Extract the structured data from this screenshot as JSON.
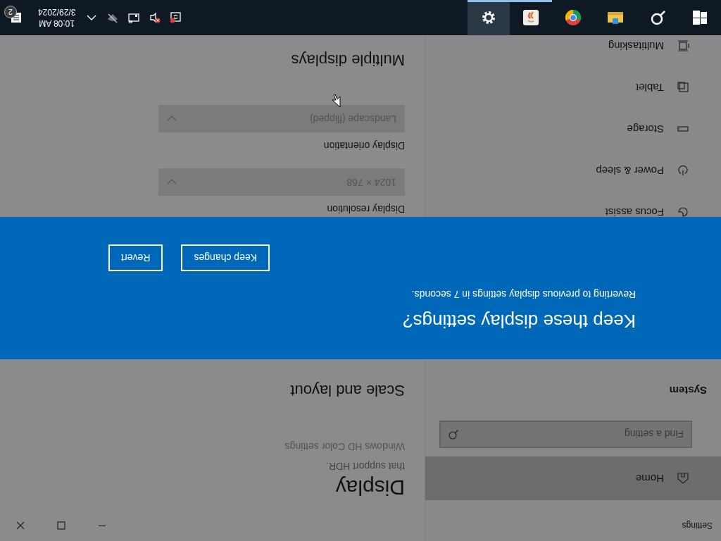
{
  "window": {
    "title": "Settings"
  },
  "sidebar": {
    "home": {
      "label": "Home",
      "selected": true
    },
    "search": {
      "placeholder": "Find a setting"
    },
    "section": "System",
    "items": [
      {
        "label": "Focus assist"
      },
      {
        "label": "Power & sleep"
      },
      {
        "label": "Storage"
      },
      {
        "label": "Tablet"
      },
      {
        "label": "Multitasking"
      }
    ]
  },
  "content": {
    "title": "Display",
    "hdr_note": "that support HDR.",
    "link": "Windows HD Color settings",
    "scale_heading": "Scale and layout",
    "settings": [
      {
        "label": "Display resolution",
        "value": "1024 × 768"
      },
      {
        "label": "Display orientation",
        "value": "Landscape (flipped)"
      }
    ],
    "multi_heading": "Multiple displays"
  },
  "dialog": {
    "title": "Keep these display settings?",
    "message": "Reverting to previous display settings in 7 seconds.",
    "buttons": [
      {
        "label": "Keep changes"
      },
      {
        "label": "Revert"
      }
    ]
  },
  "taskbar": {
    "apps": [
      {
        "kind": "start",
        "running": false,
        "selected": false
      },
      {
        "kind": "search",
        "running": false,
        "selected": false
      },
      {
        "kind": "explorer",
        "running": false,
        "selected": false
      },
      {
        "kind": "chrome",
        "running": false,
        "selected": false
      },
      {
        "kind": "app",
        "running": true,
        "selected": false
      },
      {
        "kind": "settings",
        "running": true,
        "selected": true
      }
    ],
    "time": "10:08 AM",
    "date": "3/29/2024",
    "notifications": "2"
  }
}
